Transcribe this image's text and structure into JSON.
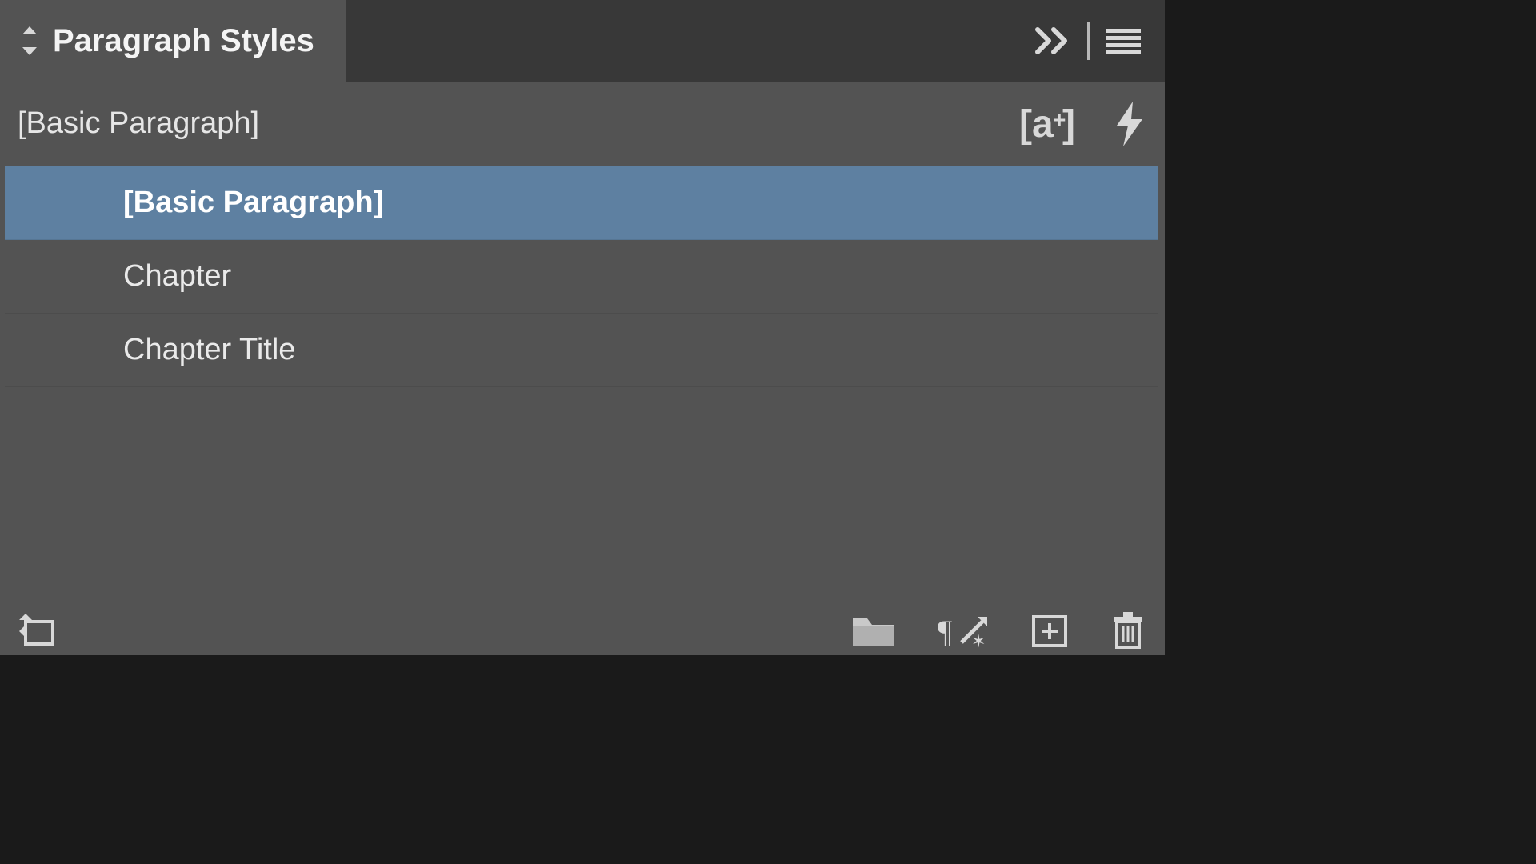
{
  "panel": {
    "tab_title": "Paragraph Styles",
    "current_style": "[Basic Paragraph]",
    "styles": [
      {
        "name": "[Basic Paragraph]",
        "selected": true
      },
      {
        "name": "Chapter",
        "selected": false
      },
      {
        "name": "Chapter Title",
        "selected": false
      }
    ],
    "icons": {
      "grip": "drag-handle",
      "collapse": "collapse-double-chevron",
      "menu": "hamburger-menu",
      "new_from_selection": "new-style-from-selection",
      "quick_apply": "quick-apply-lightning",
      "style_group": "style-group-folder",
      "clear_override": "clear-overrides",
      "new_style": "create-new-style",
      "trash": "delete-style"
    }
  }
}
